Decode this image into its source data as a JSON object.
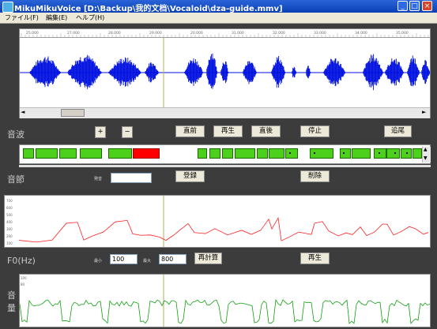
{
  "window": {
    "title": "MikuMikuVoice [D:\\Backup\\我的文档\\Vocaloid\\dza-guide.mmv]",
    "minimize": "_",
    "maximize": "□",
    "close": "×"
  },
  "menu": [
    "ファイル(F)",
    "編集(E)",
    "ヘルプ(H)"
  ],
  "ruler_ticks": [
    "25.000",
    "27.000",
    "28.000",
    "29.000",
    "20.000",
    "31.000",
    "32.000",
    "33.000",
    "34.000",
    "35.000",
    "36.000"
  ],
  "wave": {
    "label": "音波",
    "zoom_in": "+",
    "zoom_out": "−",
    "buttons": [
      "直前",
      "再生",
      "直後",
      "停止",
      "追尾"
    ],
    "scroll_left": "◄",
    "scroll_right": "►"
  },
  "syllable": {
    "label": "音節",
    "pron_label": "発音",
    "pron_value": "",
    "register": "登録",
    "delete": "削除",
    "scroll_left": "◄",
    "scroll_right": "►"
  },
  "f0": {
    "label": "F0(Hz)",
    "y_ticks": [
      "700",
      "600",
      "500",
      "400",
      "300",
      "200",
      "100"
    ],
    "min_label": "最小",
    "min_value": "100",
    "max_label": "最大",
    "max_value": "800",
    "recalc": "再計算",
    "play": "再生"
  },
  "volume": {
    "label_top": "音",
    "label_bottom": "量",
    "y_ticks": [
      "100",
      "80"
    ]
  },
  "colors": {
    "wave": "#0010e0",
    "f0": "#ff2020",
    "volume": "#10a010",
    "syllable": "#4cd01c",
    "syllable_selected": "#ff0000"
  }
}
